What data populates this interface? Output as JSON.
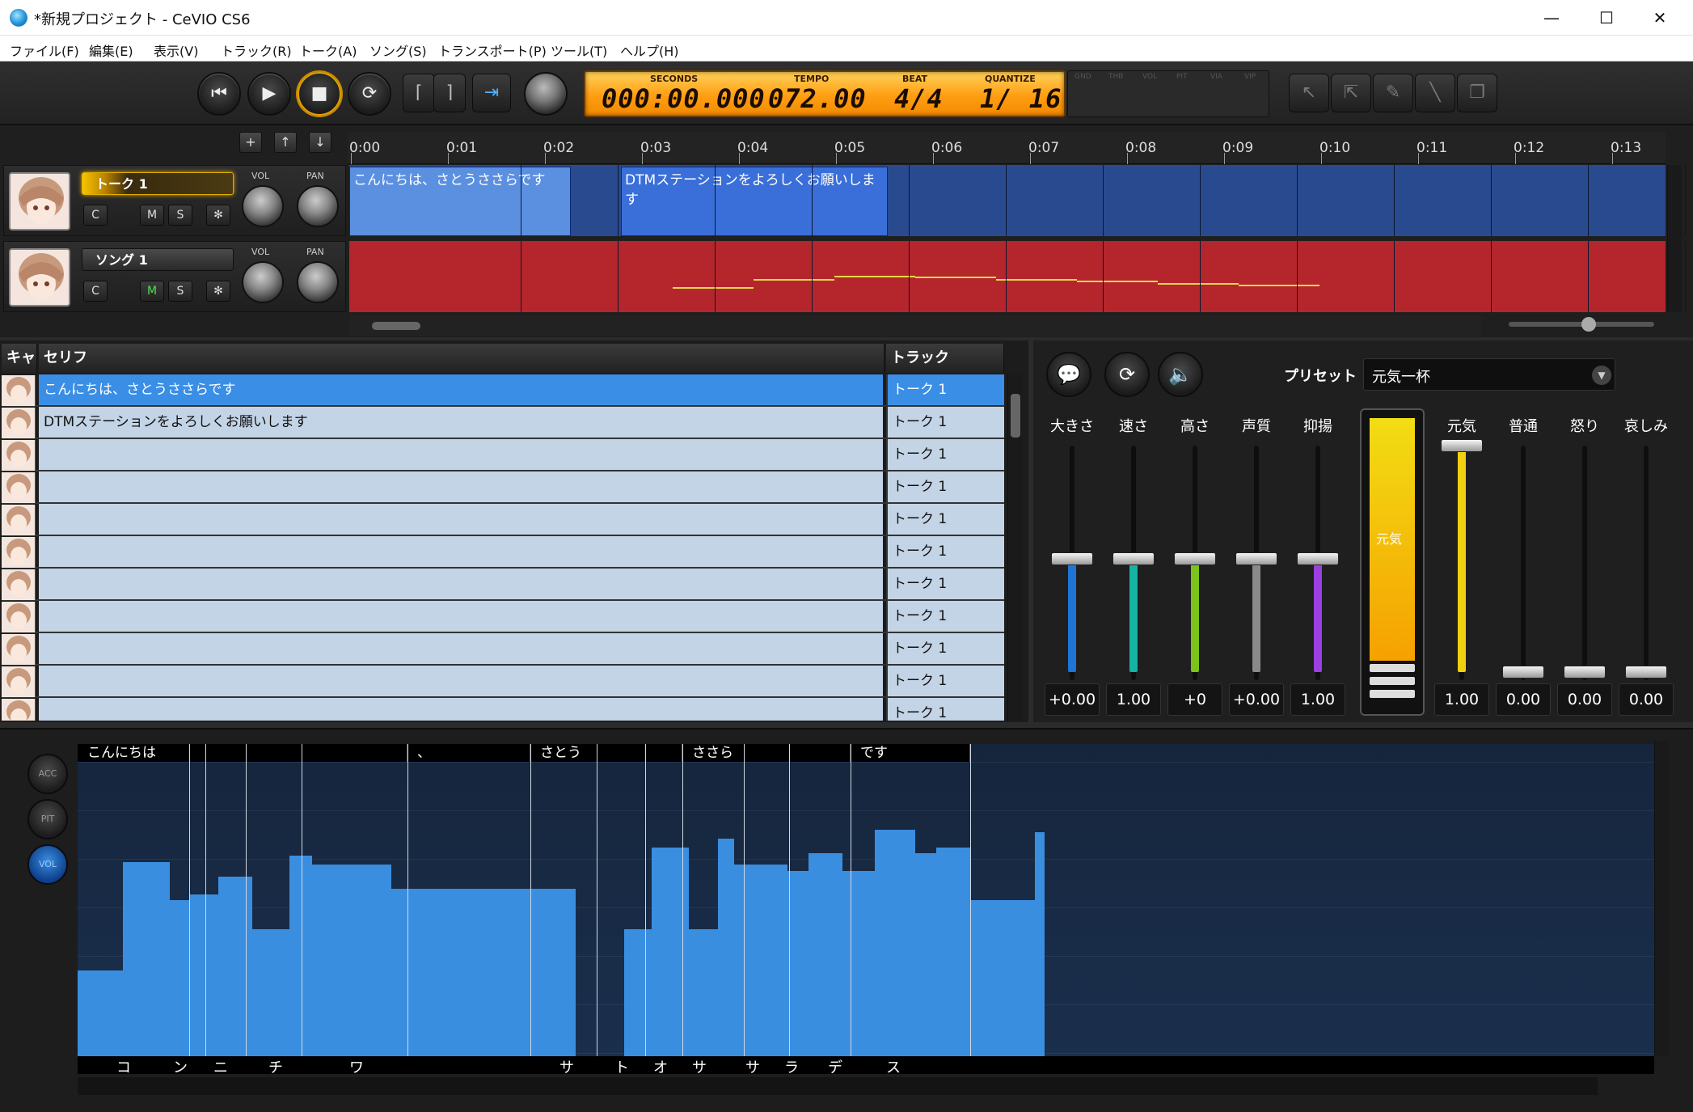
{
  "window": {
    "title": "*新規プロジェクト - CeVIO CS6",
    "minimize": "—",
    "maximize": "☐",
    "close": "✕"
  },
  "menu": [
    "ファイル(F)",
    "編集(E)",
    "表示(V)",
    "トラック(R)",
    "トーク(A)",
    "ソング(S)",
    "トランスポート(P)",
    "ツール(T)",
    "ヘルプ(H)"
  ],
  "transport": {
    "labels": {
      "seconds": "SECONDS",
      "tempo": "TEMPO",
      "beat": "BEAT",
      "quantize": "QUANTIZE"
    },
    "seconds": "000:00.000",
    "tempo": "072.00",
    "beat": "4/4",
    "quantize": "1/ 16",
    "ghost_labels": [
      "GND",
      "THB",
      "VOL",
      "PIT",
      "VIA",
      "VIP"
    ]
  },
  "ruler": [
    "0:00",
    "0:01",
    "0:02",
    "0:03",
    "0:04",
    "0:05",
    "0:06",
    "0:07",
    "0:08",
    "0:09",
    "0:10",
    "0:11",
    "0:12",
    "0:13"
  ],
  "track_buttons": {
    "add": "+",
    "up": "↑",
    "down": "↓"
  },
  "tracks": [
    {
      "name": "トーク 1",
      "vol_label": "VOL",
      "pan_label": "PAN",
      "buttons": [
        "C",
        "M",
        "S",
        "✻"
      ],
      "color": "#2a4a8f"
    },
    {
      "name": "ソング 1",
      "vol_label": "VOL",
      "pan_label": "PAN",
      "buttons": [
        "C",
        "M",
        "S",
        "✻"
      ],
      "color": "#b4262c"
    }
  ],
  "clips": [
    {
      "text": "こんにちは、さとうささらです"
    },
    {
      "text": "DTMステーションをよろしくお願いします"
    }
  ],
  "script_table": {
    "headers": {
      "cast": "キャ",
      "line": "セリフ",
      "track": "トラック"
    },
    "rows": [
      {
        "text": "こんにちは、さとうささらです",
        "track": "トーク 1",
        "selected": true
      },
      {
        "text": "DTMステーションをよろしくお願いします",
        "track": "トーク 1",
        "selected": false
      },
      {
        "text": "",
        "track": "トーク 1",
        "selected": false
      },
      {
        "text": "",
        "track": "トーク 1",
        "selected": false
      },
      {
        "text": "",
        "track": "トーク 1",
        "selected": false
      },
      {
        "text": "",
        "track": "トーク 1",
        "selected": false
      },
      {
        "text": "",
        "track": "トーク 1",
        "selected": false
      },
      {
        "text": "",
        "track": "トーク 1",
        "selected": false
      },
      {
        "text": "",
        "track": "トーク 1",
        "selected": false
      },
      {
        "text": "",
        "track": "トーク 1",
        "selected": false
      },
      {
        "text": "",
        "track": "トーク 1",
        "selected": false
      }
    ]
  },
  "emotion_panel": {
    "preset_label": "プリセット",
    "preset_value": "元気一杯",
    "params": [
      {
        "label": "大きさ",
        "value": "+0.00",
        "color": "#1f74d6",
        "level": 0.5
      },
      {
        "label": "速さ",
        "value": "1.00",
        "color": "#16b3a4",
        "level": 0.5
      },
      {
        "label": "高さ",
        "value": "+0",
        "color": "#7cc31c",
        "level": 0.5
      },
      {
        "label": "声質",
        "value": "+0.00",
        "color": "#8a8a8a",
        "level": 0.5
      },
      {
        "label": "抑揚",
        "value": "1.00",
        "color": "#9a3fe0",
        "level": 0.5
      }
    ],
    "emotion_bar_label": "元気",
    "emotions": [
      {
        "label": "元気",
        "value": "1.00",
        "color": "#f0d010",
        "level": 1.0
      },
      {
        "label": "普通",
        "value": "0.00",
        "color": "#f0d010",
        "level": 0.0
      },
      {
        "label": "怒り",
        "value": "0.00",
        "color": "#f0d010",
        "level": 0.0
      },
      {
        "label": "哀しみ",
        "value": "0.00",
        "color": "#f0d010",
        "level": 0.0
      }
    ]
  },
  "editor": {
    "side_buttons": [
      "ACC",
      "PIT",
      "VOL"
    ],
    "words": [
      "こんにちは",
      "、",
      "さとう",
      "ささら",
      "です"
    ],
    "kana": [
      "コ",
      "ン",
      "ニ",
      "チ",
      "ワ",
      "サ",
      "ト",
      "オ",
      "サ",
      "サ",
      "ラ",
      "デ",
      "ス"
    ],
    "volume_levels": [
      0.29,
      0.66,
      0.53,
      0.55,
      0.61,
      0.43,
      0.68,
      0.65,
      0.57,
      0.57,
      0.0,
      0.43,
      0.71,
      0.43,
      0.74,
      0.65,
      0.63,
      0.69,
      0.63,
      0.77,
      0.69,
      0.71,
      0.53,
      0.76,
      0.59,
      0.34
    ]
  }
}
